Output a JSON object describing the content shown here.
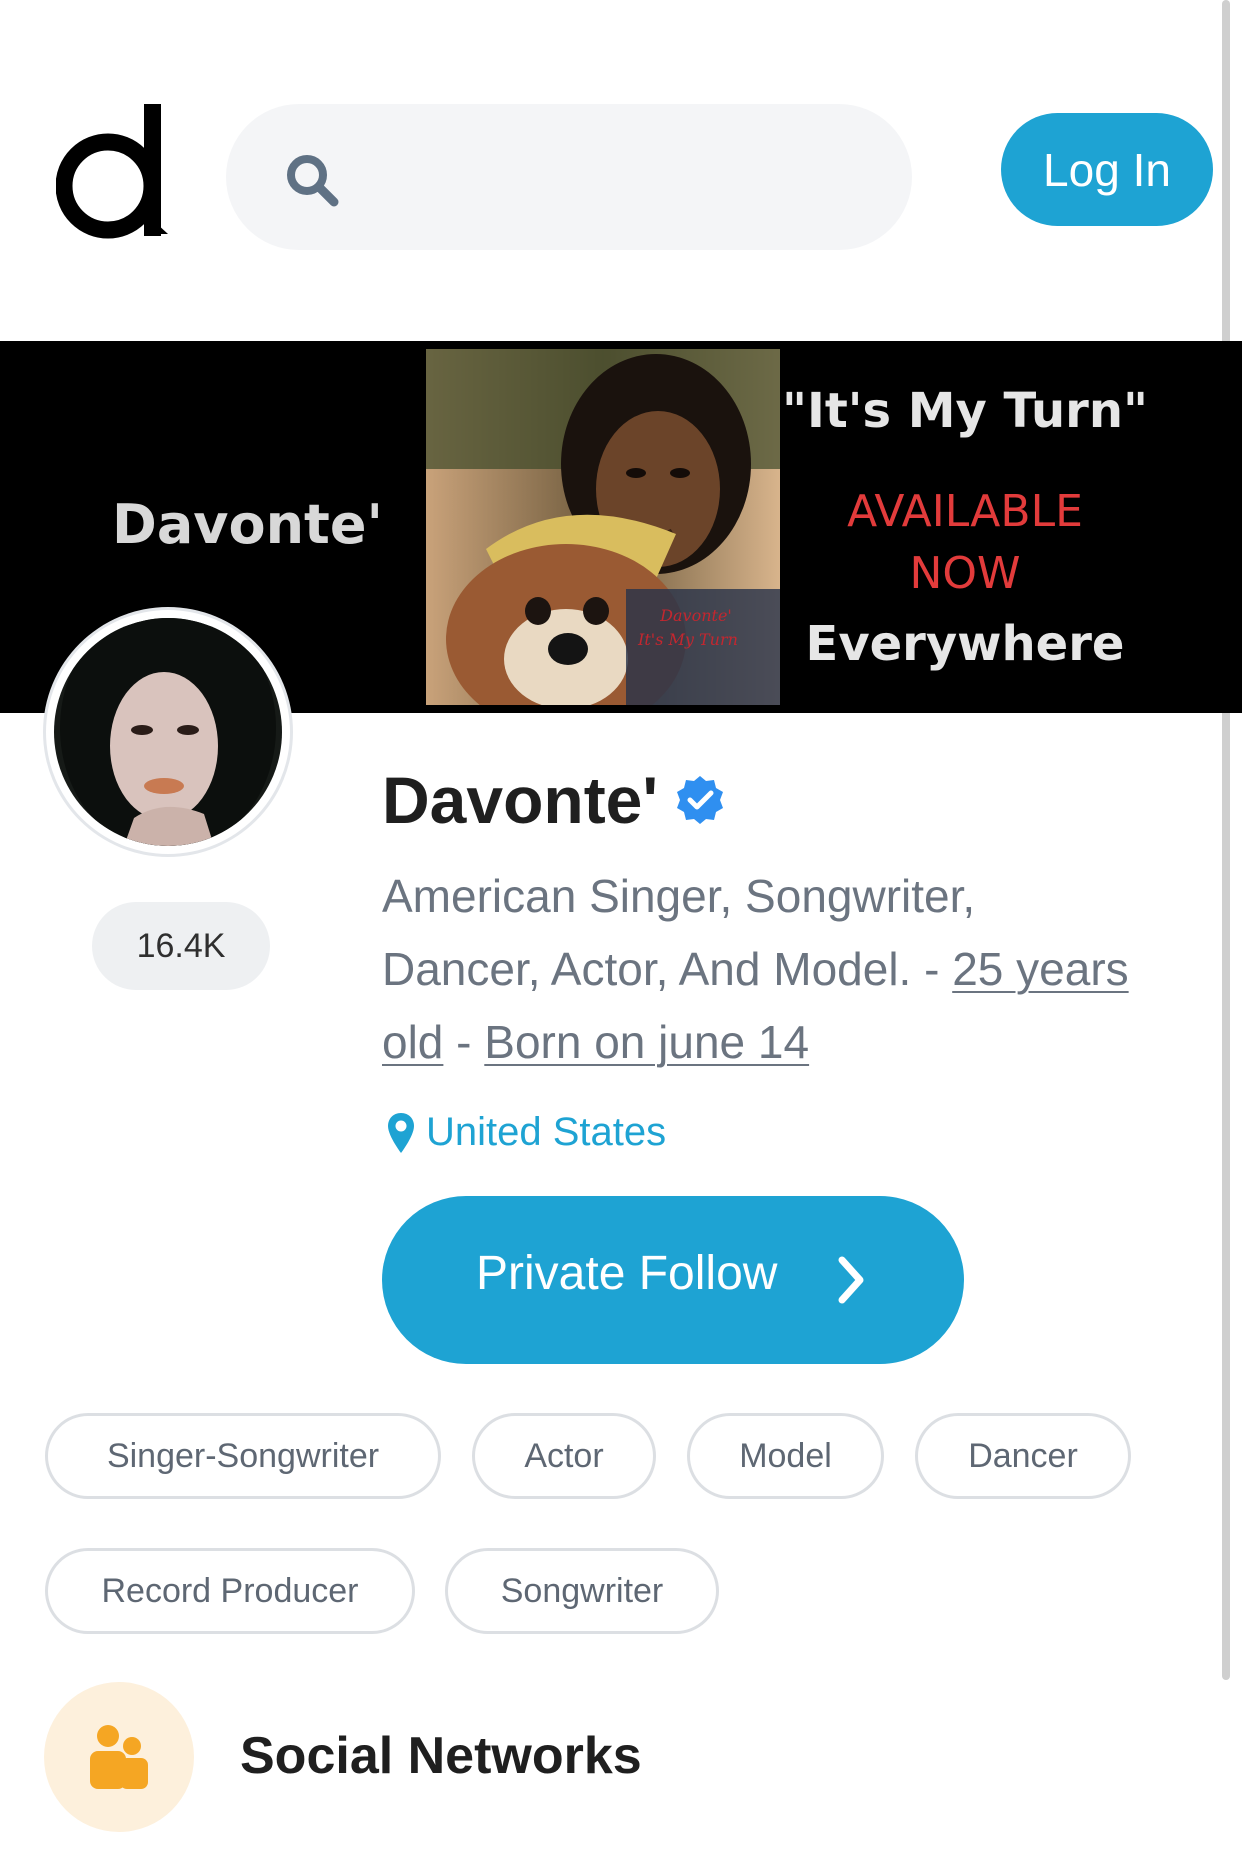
{
  "header": {
    "logo_icon": "app-logo-icon",
    "search": {
      "icon": "search-icon",
      "value": "",
      "placeholder": ""
    },
    "login_label": "Log In"
  },
  "banner": {
    "artist_name": "Davonte'",
    "title": "\"It's My Turn\"",
    "available_line1": "AVAILABLE",
    "available_line2": "NOW",
    "everywhere": "Everywhere",
    "cover_text_line1": "Davonte'",
    "cover_text_line2": "It's My Turn"
  },
  "profile": {
    "name": "Davonte'",
    "verified_icon": "verified-badge-icon",
    "followers": "16.4K",
    "bio_text": "American Singer, Songwriter, Dancer, Actor, And Model. - ",
    "age_link": "25 years old",
    "bio_separator": " - ",
    "birthday_link": "Born on june 14",
    "location": "United States",
    "location_icon": "map-pin-icon",
    "follow_label": "Private Follow",
    "follow_icon": "chevron-right-icon"
  },
  "tags": [
    "Singer-Songwriter",
    "Actor",
    "Model",
    "Dancer",
    "Record Producer",
    "Songwriter"
  ],
  "social_networks": {
    "icon": "users-icon",
    "title": "Social Networks"
  },
  "colors": {
    "accent": "#1ea3d3",
    "verified": "#2f8ff0",
    "banner_bg": "#000000",
    "available_red": "#e23b3b",
    "social_icon_bg": "#fdf0dc",
    "social_icon": "#f5a623"
  }
}
